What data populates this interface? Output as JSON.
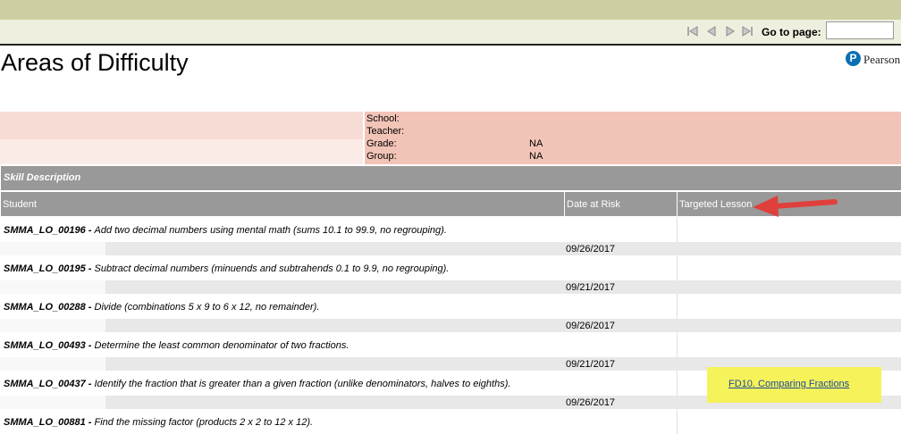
{
  "toolbar": {
    "goto_label": "Go to page:",
    "goto_value": ""
  },
  "page": {
    "title": "Areas of Difficulty",
    "logo_letter": "P",
    "logo_text": "Pearson"
  },
  "info": [
    {
      "label": "School:",
      "value": ""
    },
    {
      "label": "Teacher:",
      "value": ""
    },
    {
      "label": "Grade:",
      "value": "NA"
    },
    {
      "label": "Group:",
      "value": "NA"
    }
  ],
  "table": {
    "skill_header": "Skill Description",
    "columns": {
      "student": "Student",
      "date": "Date at Risk",
      "lesson": "Targeted Lesson"
    },
    "rows": [
      {
        "code": "SMMA_LO_00196",
        "sep": " - ",
        "desc": "Add two decimal numbers using mental math (sums 10.1 to 99.9, no regrouping).",
        "date": "09/26/2017",
        "lesson": ""
      },
      {
        "code": "SMMA_LO_00195",
        "sep": " - ",
        "desc": "Subtract decimal numbers (minuends and subtrahends 0.1 to 9.9, no regrouping).",
        "date": "09/21/2017",
        "lesson": ""
      },
      {
        "code": "SMMA_LO_00288",
        "sep": " - ",
        "desc": "Divide (combinations 5 x 9 to 6 x 12, no remainder).",
        "date": "09/26/2017",
        "lesson": ""
      },
      {
        "code": "SMMA_LO_00493",
        "sep": " - ",
        "desc": "Determine the least common denominator of two fractions.",
        "date": "09/21/2017",
        "lesson": ""
      },
      {
        "code": "SMMA_LO_00437",
        "sep": " - ",
        "desc": "Identify the fraction that is greater than a given fraction (unlike denominators, halves to eighths).",
        "date": "09/26/2017",
        "lesson": "FD10. Comparing Fractions"
      },
      {
        "code": "SMMA_LO_00881",
        "sep": " - ",
        "desc": "Find the missing factor (products 2 x 2 to 12 x 12).",
        "date": "",
        "lesson": ""
      }
    ]
  },
  "colors": {
    "topbar": "#cdcfa2",
    "header": "#999999",
    "info_panel": "#f2c4b7",
    "highlight": "#f6f25a",
    "arrow": "#e0403c",
    "link": "#1a4b99"
  },
  "icons": [
    "first-page-icon",
    "prev-page-icon",
    "next-page-icon",
    "last-page-icon",
    "annotation-arrow-icon"
  ]
}
